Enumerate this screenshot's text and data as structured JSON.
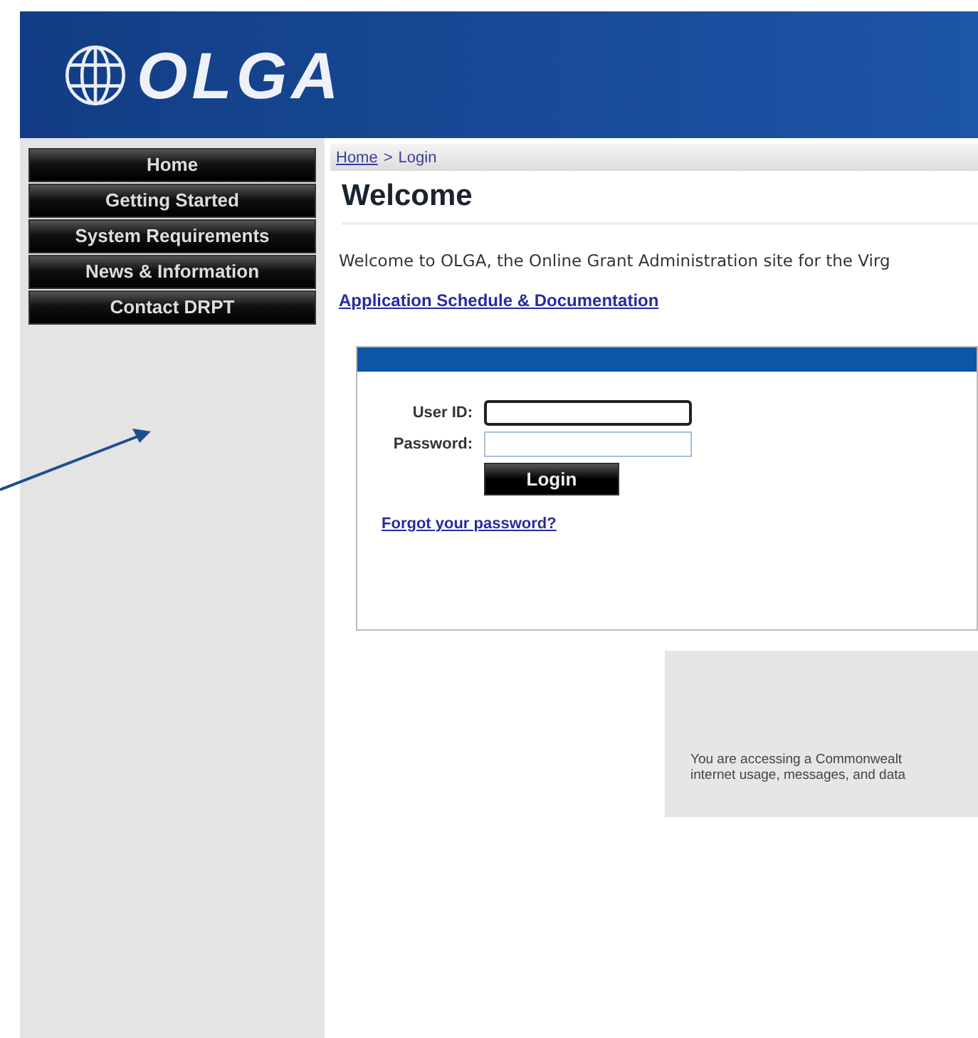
{
  "header": {
    "logo": "OLGA"
  },
  "sidebar": {
    "items": [
      {
        "label": "Home"
      },
      {
        "label": "Getting Started"
      },
      {
        "label": "System Requirements"
      },
      {
        "label": "News & Information"
      },
      {
        "label": "Contact DRPT"
      }
    ]
  },
  "breadcrumb": {
    "link": "Home",
    "separator": ">",
    "current": "Login"
  },
  "title": "Welcome",
  "intro": "Welcome to OLGA, the Online Grant Administration site for the Virg",
  "doc_link": "Application Schedule & Documentation",
  "login": {
    "user_label": "User ID:",
    "password_label": "Password:",
    "button": "Login",
    "forgot": "Forgot your password?"
  },
  "notice": [
    "You are accessing a Commonwealt",
    "internet usage, messages, and data"
  ]
}
